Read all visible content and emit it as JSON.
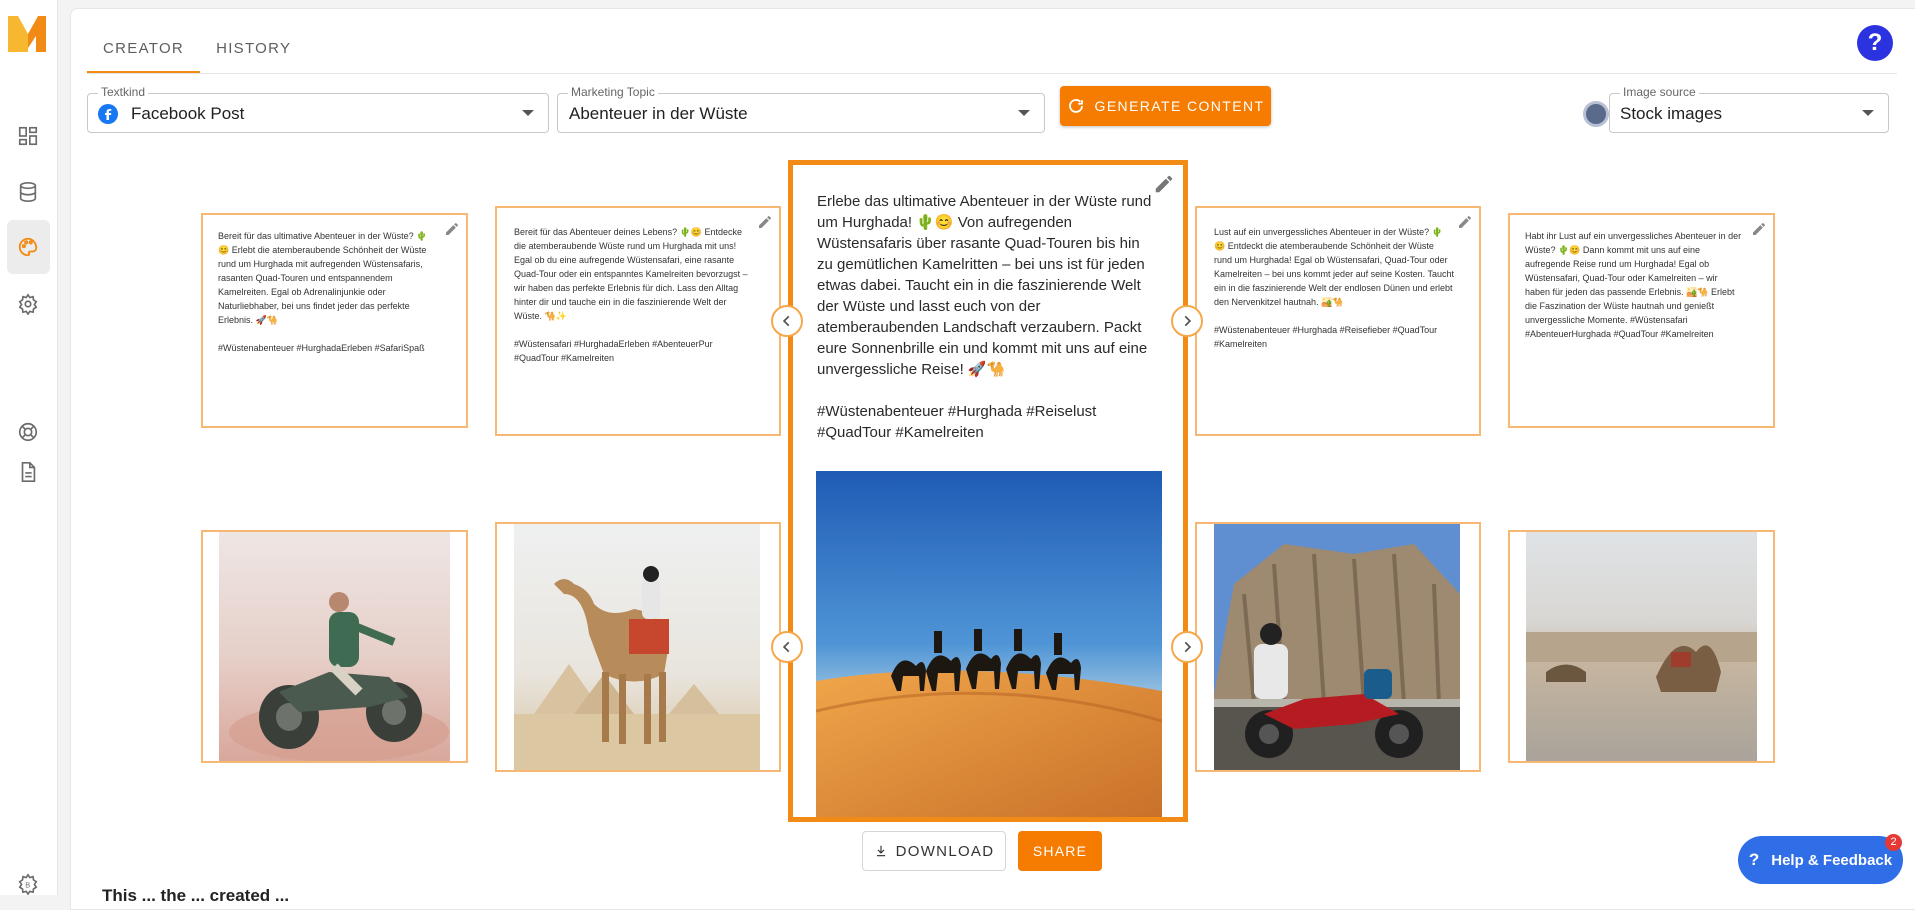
{
  "tabs": [
    {
      "label": "CREATOR"
    },
    {
      "label": "HISTORY"
    }
  ],
  "help_label": "?",
  "form": {
    "textkind": {
      "label": "Textkind",
      "value": "Facebook Post"
    },
    "topic": {
      "label": "Marketing Topic",
      "value": "Abenteuer in der Wüste"
    },
    "generate_label": "GENERATE CONTENT",
    "image_source": {
      "label": "Image source",
      "value": "Stock images"
    }
  },
  "cards": [
    {
      "text": "Bereit für das ultimative Abenteuer in der Wüste? 🌵 😊 Erlebt die atemberaubende Schönheit der Wüste rund um Hurghada mit aufregenden Wüstensafaris, rasanten Quad-Touren und entspannendem Kamelreiten. Egal ob Adrenalinjunkie oder Naturliebhaber, bei uns findet jeder das perfekte Erlebnis. 🚀🐪\n\n#Wüstenabenteuer #HurghadaErleben #SafariSpaß"
    },
    {
      "text": "Bereit für das Abenteuer deines Lebens? 🌵😊 Entdecke die atemberaubende Wüste rund um Hurghada mit uns! Egal ob du eine aufregende Wüstensafari, eine rasante Quad-Tour oder ein entspanntes Kamelreiten bevorzugst – wir haben das perfekte Erlebnis für dich. Lass den Alltag hinter dir und tauche ein in die faszinierende Welt der Wüste. 🐪✨\n\n#Wüstensafari #HurghadaErleben #AbenteuerPur #QuadTour #Kamelreiten"
    },
    {
      "text": "Erlebe das ultimative Abenteuer in der Wüste rund um Hurghada! 🌵😊 Von aufregenden Wüstensafaris über rasante Quad-Touren bis hin zu gemütlichen Kamelritten – bei uns ist für jeden etwas dabei. Taucht ein in die faszinierende Welt der Wüste und lasst euch von der atemberaubenden Landschaft verzaubern. Packt eure Sonnenbrille ein und kommt mit uns auf eine unvergessliche Reise! 🚀🐪\n\n#Wüstenabenteuer #Hurghada #Reiselust #QuadTour #Kamelreiten"
    },
    {
      "text": "Lust auf ein unvergessliches Abenteuer in der Wüste? 🌵😊 Entdeckt die atemberaubende Schönheit der Wüste rund um Hurghada! Egal ob Wüstensafari, Quad-Tour oder Kamelreiten – bei uns kommt jeder auf seine Kosten. Taucht ein in die faszinierende Welt der endlosen Dünen und erlebt den Nervenkitzel hautnah. 🏜️🐪\n\n#Wüstenabenteuer #Hurghada #Reisefieber #QuadTour #Kamelreiten"
    },
    {
      "text": "Habt ihr Lust auf ein unvergessliches Abenteuer in der Wüste? 🌵😊 Dann kommt mit uns auf eine aufregende Reise rund um Hurghada! Egal ob Wüstensafari, Quad-Tour oder Kamelreiten – wir haben für jeden das passende Erlebnis. 🏜️🐪 Erlebt die Faszination der Wüste hautnah und genießt unvergessliche Momente. #Wüstensafari #AbenteuerHurghada #QuadTour #Kamelreiten"
    }
  ],
  "download_label": "DOWNLOAD",
  "share_label": "SHARE",
  "feedback_label": "Help & Feedback",
  "feedback_badge": "2",
  "bottom_heading": "This ... the ... created ..."
}
